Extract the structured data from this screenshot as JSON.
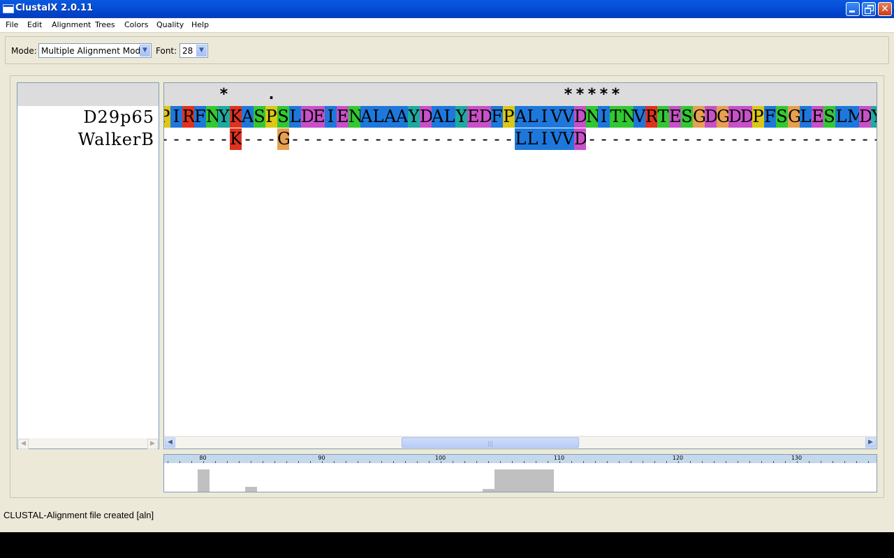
{
  "window": {
    "title": "ClustalX 2.0.11"
  },
  "menu": [
    "File",
    "Edit",
    "Alignment",
    "Trees",
    "Colors",
    "Quality",
    "Help"
  ],
  "toolbar": {
    "mode_label": "Mode:",
    "mode_value": "Multiple Alignment Mode",
    "font_label": "Font:",
    "font_value": "28"
  },
  "colors": {
    "blue": "#1e78dc",
    "red": "#e0321e",
    "green": "#32c832",
    "cyan": "#1eaaa0",
    "magenta": "#c850c8",
    "yellow": "#dcc814",
    "orange": "#e6a050",
    "gap": "#ffffff"
  },
  "alignment": {
    "first_col": 80,
    "conservation": "     *   .                        *****                          ",
    "sequences": [
      {
        "name": "D29p65",
        "residues": "PIRFNYKASPSLDEIENALAAYDALYEDFPALIVVDNITNVRTESGDGDDPFSGLESLMDY"
      },
      {
        "name": "WalkerB",
        "residues": "------K---G-------------------LLIVVD-------------------------"
      }
    ]
  },
  "quality_scale": [
    80,
    90,
    100,
    110,
    120,
    130
  ],
  "quality_bars": [
    {
      "col": 85,
      "h": 32
    },
    {
      "col": 89,
      "h": 7
    },
    {
      "col": 109,
      "h": 4
    },
    {
      "col": 110,
      "h": 32
    },
    {
      "col": 111,
      "h": 32
    },
    {
      "col": 112,
      "h": 32
    },
    {
      "col": 113,
      "h": 32
    },
    {
      "col": 114,
      "h": 32
    }
  ],
  "status": "CLUSTAL-Alignment file created  [aln]"
}
